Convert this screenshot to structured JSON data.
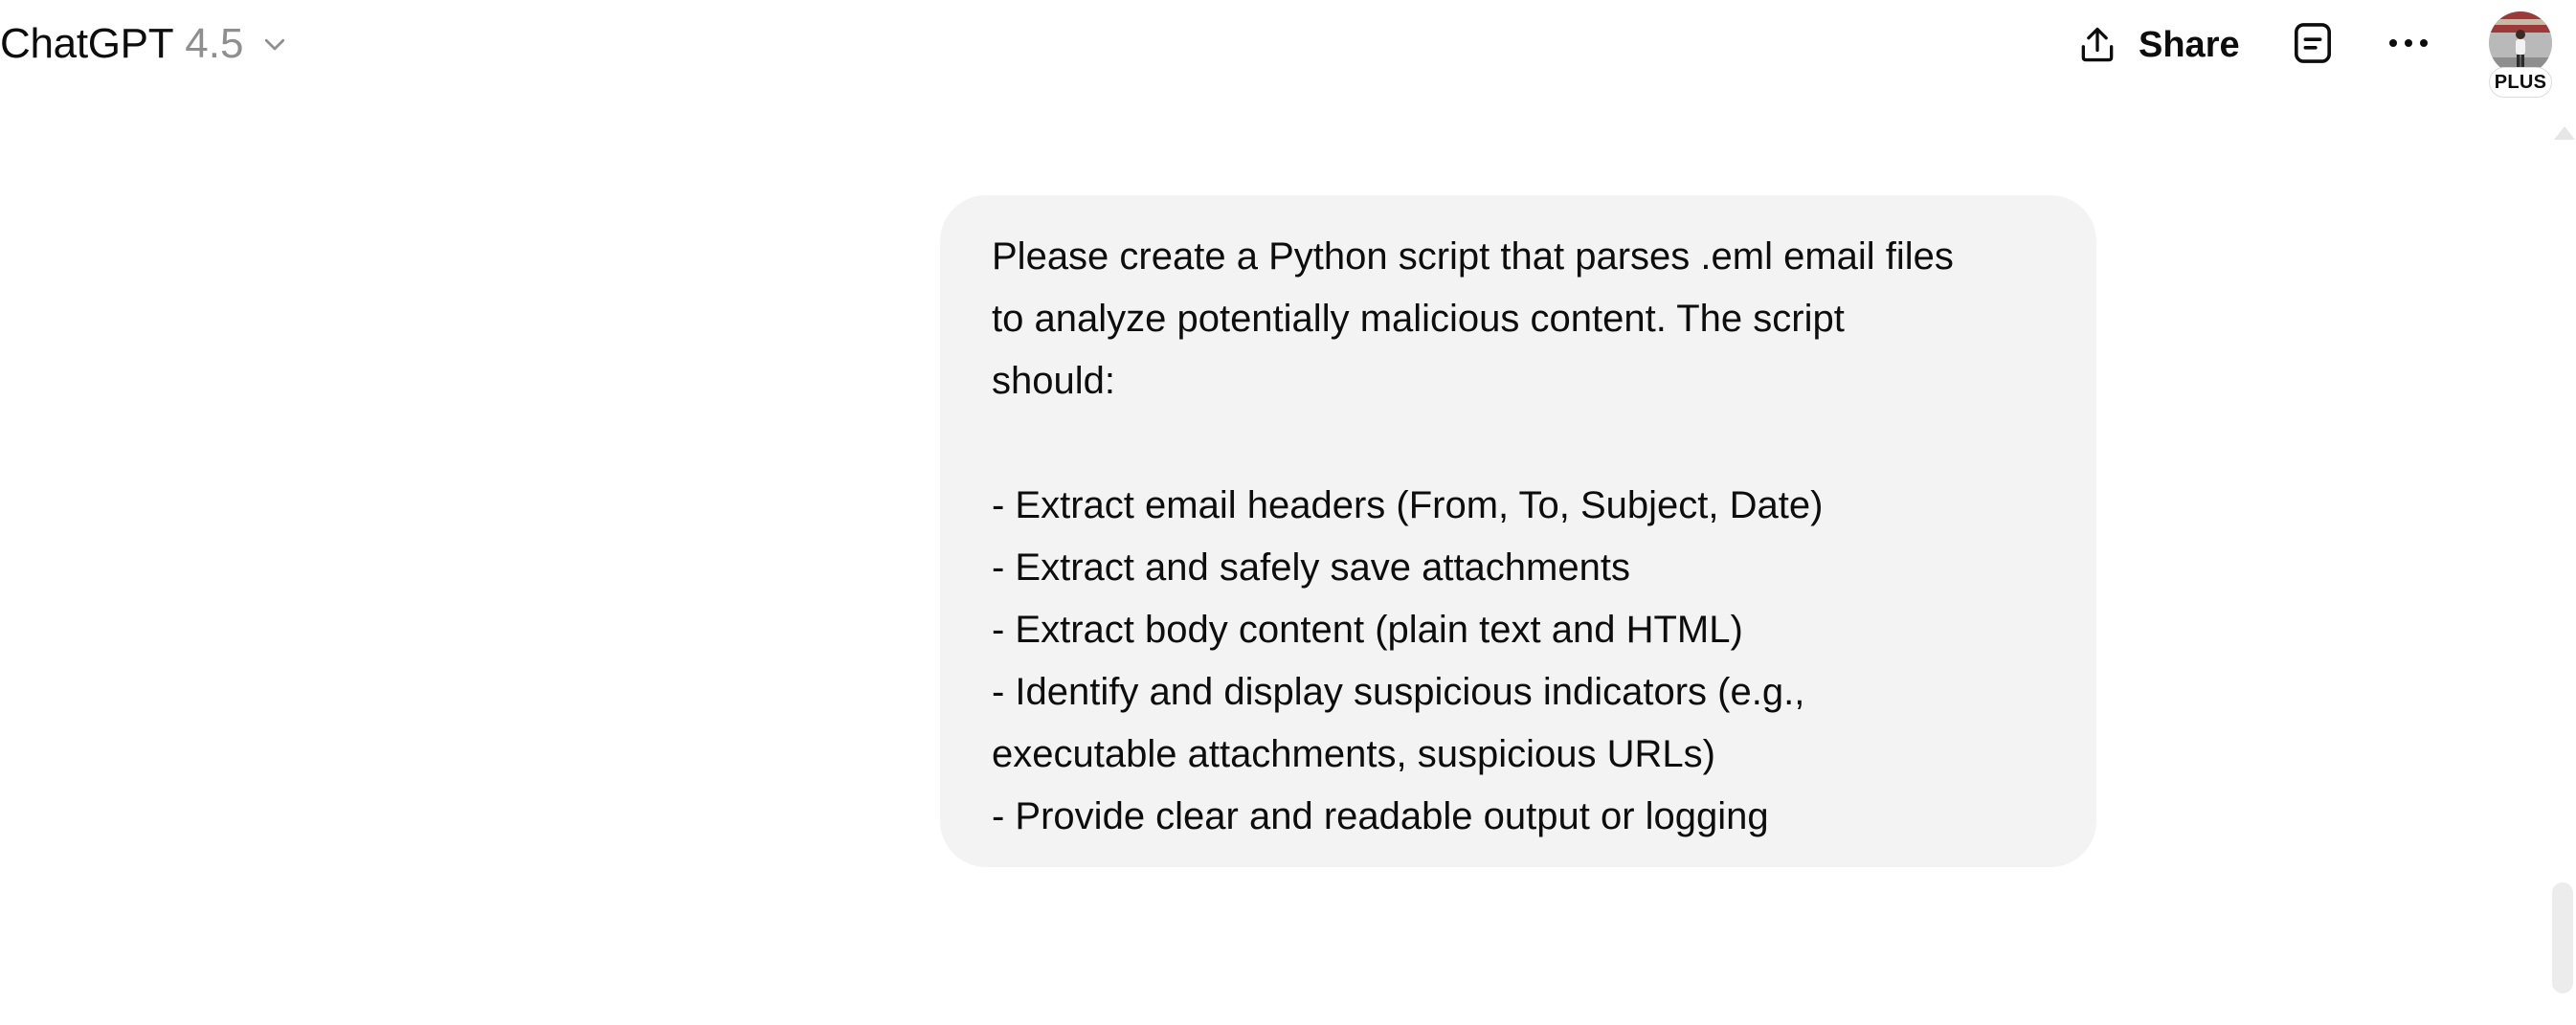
{
  "header": {
    "brand": "ChatGPT",
    "model_version": "4.5",
    "share_label": "Share",
    "plus_badge": "PLUS"
  },
  "icons": {
    "model_dropdown": "chevron-down-icon",
    "share": "share-upload-icon",
    "notes": "document-icon",
    "more": "more-horizontal-icon"
  },
  "message": {
    "role": "user",
    "lines": [
      "Please create a Python script that parses .eml email files",
      "to analyze potentially malicious content. The script",
      "should:",
      "",
      "- Extract email headers (From, To, Subject, Date)",
      "- Extract and safely save attachments",
      "- Extract body content (plain text and HTML)",
      "- Identify and display suspicious indicators (e.g.,",
      "executable attachments, suspicious URLs)",
      "- Provide clear and readable output or logging"
    ]
  },
  "colors": {
    "bubble_bg": "#f3f3f3",
    "text": "#0d0d0d",
    "muted": "#8f8f8f"
  }
}
